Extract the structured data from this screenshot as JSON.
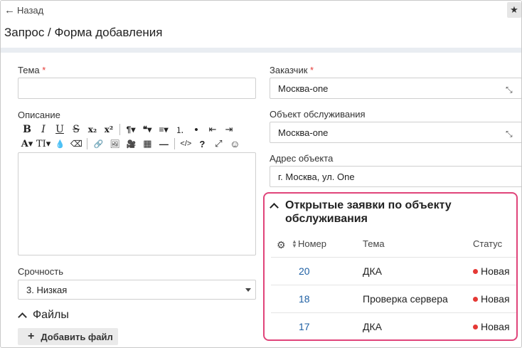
{
  "header": {
    "back_label": "Назад",
    "title": "Запрос / Форма добавления",
    "star_icon": "star-icon"
  },
  "form": {
    "topic_label": "Тема",
    "topic_required": "*",
    "topic_value": "",
    "description_label": "Описание",
    "urgency_label": "Срочность",
    "urgency_value": "3. Низкая",
    "files_label": "Файлы",
    "add_file_label": "Добавить файл",
    "customer_label": "Заказчик",
    "customer_required": "*",
    "customer_value": "Москва-one",
    "object_label": "Объект обслуживания",
    "object_value": "Москва-one",
    "address_label": "Адрес объекта",
    "address_value": "г. Москва, ул. One"
  },
  "toolbar": {
    "row1": [
      "B",
      "I",
      "U",
      "S",
      "x₂",
      "x²",
      "¶▾",
      "❝▾",
      "≡▾",
      "⒈",
      "•",
      "⇤",
      "⇥"
    ],
    "row2": [
      "A▾",
      "TI▾",
      "💧",
      "⌫",
      "🔗",
      "🖼",
      "🎥",
      "▦",
      "—",
      "</>",
      "?",
      "⤢",
      "☺"
    ]
  },
  "open_requests": {
    "title": "Открытые заявки по объекту обслуживания",
    "columns": {
      "number": "Номер",
      "topic": "Тема",
      "status": "Статус"
    },
    "rows": [
      {
        "number": "20",
        "topic": "ДКА",
        "status": "Новая"
      },
      {
        "number": "18",
        "topic": "Проверка сервера",
        "status": "Новая"
      },
      {
        "number": "17",
        "topic": "ДКА",
        "status": "Новая"
      }
    ],
    "status_color": "#e53935",
    "highlight_color": "#e0447a"
  }
}
